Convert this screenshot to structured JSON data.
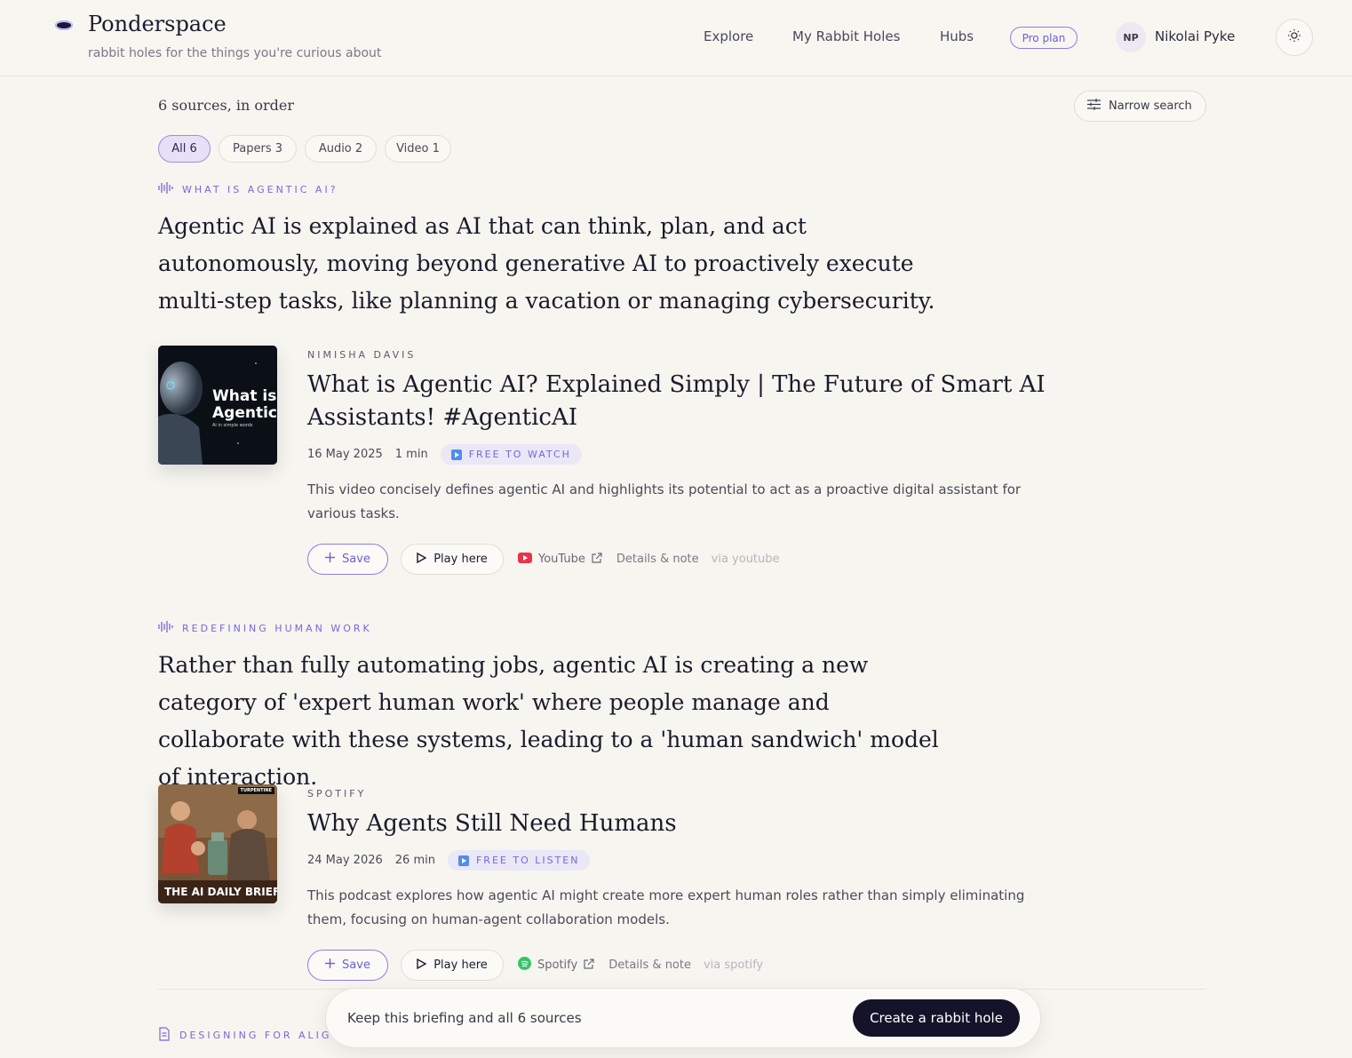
{
  "header": {
    "brand": "Ponderspace",
    "tagline": "rabbit holes for the things you're curious about",
    "nav": [
      "Explore",
      "My Rabbit Holes",
      "Hubs"
    ],
    "plan_badge": "Pro plan",
    "user_initials": "NP",
    "user_name": "Nikolai Pyke"
  },
  "results": {
    "count_label": "6 sources, in order",
    "narrow_label": "Narrow search",
    "filters": [
      {
        "label": "All 6",
        "active": true
      },
      {
        "label": "Papers 3",
        "active": false
      },
      {
        "label": "Audio 2",
        "active": false
      },
      {
        "label": "Video 1",
        "active": false
      }
    ]
  },
  "sections": [
    {
      "eyebrow": "WHAT IS AGENTIC AI?",
      "summary": "Agentic AI is explained as AI that can think, plan, and act autonomously, moving beyond generative AI to proactively execute multi-step tasks, like planning a vacation or managing cybersecurity.",
      "item": {
        "thumb_text_1": "What is",
        "thumb_text_2": "Agentic",
        "thumb_text_3": "Ai in simple words",
        "source": "NIMISHA DAVIS",
        "title": "What is Agentic AI? Explained Simply | The Future of Smart AI Assistants! #AgenticAI",
        "date": "16 May 2025",
        "duration": "1 min",
        "access": "FREE TO WATCH",
        "description": "This video concisely defines agentic AI and highlights its potential to act as a proactive digital assistant for various tasks.",
        "save": "Save",
        "play": "Play here",
        "platform": "YouTube",
        "details": "Details & note",
        "via": "via youtube"
      }
    },
    {
      "eyebrow": "REDEFINING HUMAN WORK",
      "summary": "Rather than fully automating jobs, agentic AI is creating a new category of 'expert human work' where people manage and collaborate with these systems, leading to a 'human sandwich' model of interaction.",
      "item": {
        "thumb_text_1": "TURPENTINE",
        "thumb_text_2": "THE AI DAILY BRIEF",
        "source": "SPOTIFY",
        "title": "Why Agents Still Need Humans",
        "date": "24 May 2026",
        "duration": "26 min",
        "access": "FREE TO LISTEN",
        "description": "This podcast explores how agentic AI might create more expert human roles rather than simply eliminating them, focusing on human-agent collaboration models.",
        "save": "Save",
        "play": "Play here",
        "platform": "Spotify",
        "details": "Details & note",
        "via": "via spotify"
      }
    },
    {
      "eyebrow": "DESIGNING FOR ALIG"
    }
  ],
  "banner": {
    "text": "Keep this briefing and all 6 sources",
    "cta": "Create a rabbit hole"
  },
  "colors": {
    "accent": "#7668d8",
    "background": "#f7f5f0",
    "cta_bg": "#14132a",
    "youtube": "#e8344a",
    "spotify": "#34c46a"
  }
}
